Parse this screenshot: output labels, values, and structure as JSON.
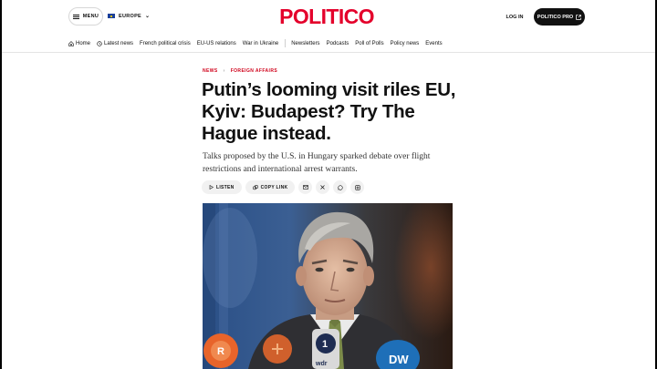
{
  "header": {
    "menu_label": "MENU",
    "region_label": "EUROPE",
    "logo": "POLITICO",
    "login_label": "LOG IN",
    "pro_label": "POLITICO PRO"
  },
  "nav": {
    "home": "Home",
    "latest": "Latest news",
    "items": [
      "French political crisis",
      "EU-US relations",
      "War in Ukraine"
    ],
    "items2": [
      "Newsletters",
      "Podcasts",
      "Poll of Polls",
      "Policy news",
      "Events"
    ]
  },
  "article": {
    "section": "NEWS",
    "subsection": "FOREIGN AFFAIRS",
    "headline": "Putin’s looming visit riles EU, Kyiv: Budapest? Try The Hague instead.",
    "subtitle": "Talks proposed by the U.S. in Hungary sparked debate over flight restrictions and international arrest warrants.",
    "listen_label": "LISTEN",
    "copy_label": "COPY LINK",
    "mic_logo_1": "wdr",
    "mic_logo_2": "DW"
  },
  "colors": {
    "brand": "#e4002b",
    "section": "#d0021b"
  }
}
